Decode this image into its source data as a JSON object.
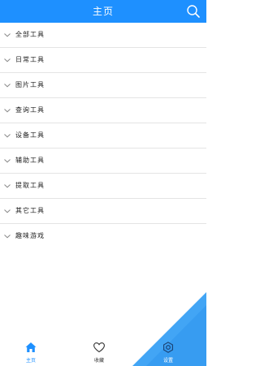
{
  "header": {
    "title": "主页",
    "search_icon": "search-icon",
    "color": "#1e90ff"
  },
  "categories": [
    {
      "label": "全部工具",
      "icon": "chevron-down-icon"
    },
    {
      "label": "日常工具",
      "icon": "chevron-down-icon"
    },
    {
      "label": "图片工具",
      "icon": "chevron-down-icon"
    },
    {
      "label": "查询工具",
      "icon": "chevron-down-icon"
    },
    {
      "label": "设备工具",
      "icon": "chevron-down-icon"
    },
    {
      "label": "辅助工具",
      "icon": "chevron-down-icon"
    },
    {
      "label": "提取工具",
      "icon": "chevron-down-icon"
    },
    {
      "label": "其它工具",
      "icon": "chevron-down-icon"
    },
    {
      "label": "趣味游戏",
      "icon": "chevron-down-icon"
    }
  ],
  "bottom_nav": {
    "items": [
      {
        "label": "主页",
        "icon": "home-icon",
        "active": true
      },
      {
        "label": "收藏",
        "icon": "heart-icon",
        "active": false
      },
      {
        "label": "设置",
        "icon": "settings-icon",
        "active": false
      }
    ],
    "active_color": "#1e90ff"
  },
  "accent_color": "#42a5f5"
}
